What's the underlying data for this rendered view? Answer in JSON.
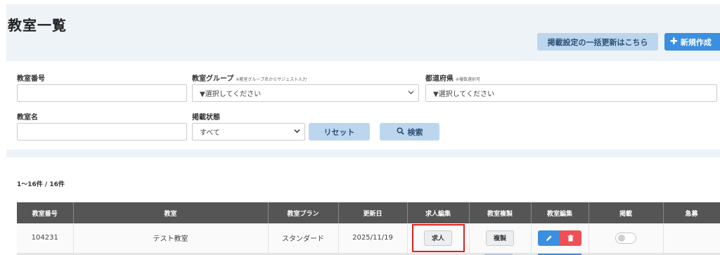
{
  "page": {
    "title": "教室一覧"
  },
  "header_actions": {
    "bulk_update_label": "掲載設定の一括更新はこちら",
    "new_label": "新規作成"
  },
  "filters": {
    "room_number": {
      "label": "教室番号",
      "value": ""
    },
    "room_group": {
      "label": "教室グループ",
      "note": "※教室グループ名からサジェスト入力",
      "value": "▼選択してください"
    },
    "prefecture": {
      "label": "都道府県",
      "note": "※複数選択可",
      "value": "▼選択してください"
    },
    "room_name": {
      "label": "教室名",
      "value": ""
    },
    "publish_status": {
      "label": "掲載状態",
      "value": "すべて"
    },
    "reset_label": "リセット",
    "search_label": "検索"
  },
  "results": {
    "count_text": "1〜16件 / 16件",
    "columns": [
      "教室番号",
      "教室",
      "教室プラン",
      "更新日",
      "求人編集",
      "教室複製",
      "教室編集",
      "掲載",
      "急募"
    ],
    "rows": [
      {
        "number": "104231",
        "name": "テスト教室",
        "plan": "スタンダード",
        "updated": "2025/11/19",
        "job_label": "求人",
        "copy_label": "複製",
        "published": false
      }
    ]
  },
  "icons": {
    "new": "plus-icon",
    "search": "search-icon",
    "edit": "pencil-icon",
    "delete": "trash-icon",
    "select": "chevron-down-icon"
  },
  "colors": {
    "primary": "#3b8fe0",
    "secondary_button": "#bcd6ee",
    "danger": "#ef5056",
    "table_header": "#555555",
    "highlight": "#e12020",
    "page_bg": "#eef3f8"
  }
}
